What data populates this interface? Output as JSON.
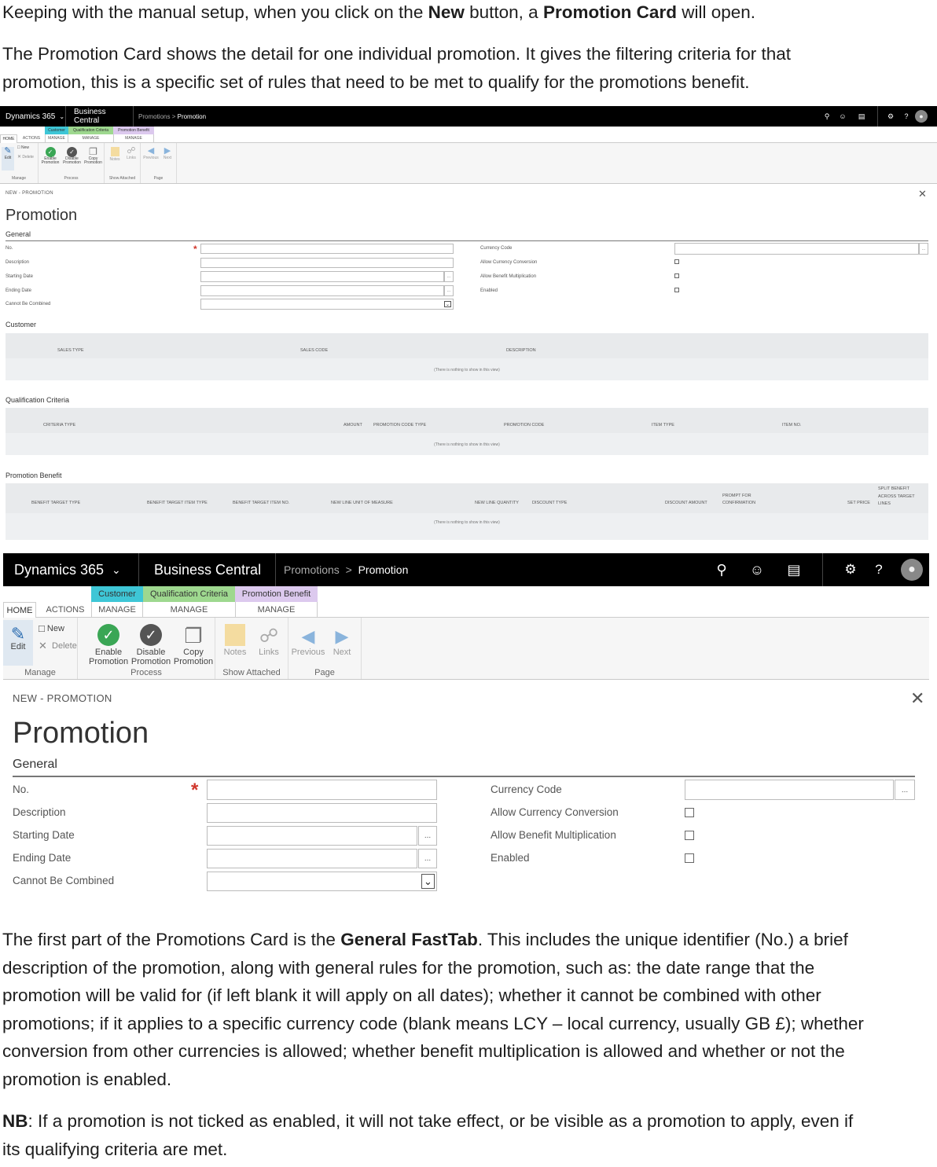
{
  "intro": {
    "p1": {
      "t1": "Keeping with the manual setup, when you click on the ",
      "b1": "New",
      "t2": " button, a ",
      "b2": "Promotion Card",
      "t3": " will open."
    },
    "p2_line1": "The Promotion Card shows the detail for one individual promotion. It gives the filtering criteria for that",
    "p2_line2": "promotion, this is a specific set of rules that need to be met to qualify for the promotions benefit."
  },
  "app": {
    "product": "Dynamics 365",
    "app_name": "Business Central",
    "breadcrumb_parent": "Promotions",
    "breadcrumb_sep": ">",
    "breadcrumb_current": "Promotion",
    "icons": [
      "search-icon",
      "smiley-icon",
      "chat-icon",
      "gear-icon",
      "help-icon",
      "avatar-icon"
    ],
    "help_glyph": "?"
  },
  "ribbon": {
    "contexts": {
      "customer": "Customer",
      "qualification": "Qualification Criteria",
      "benefit": "Promotion Benefit"
    },
    "tabs": {
      "home": "HOME",
      "actions": "ACTIONS",
      "manage1": "MANAGE",
      "manage2": "MANAGE",
      "manage3": "MANAGE"
    },
    "buttons": {
      "edit": "Edit",
      "new": "New",
      "delete": "Delete",
      "enable_1": "Enable",
      "enable_2": "Promotion",
      "disable_1": "Disable",
      "disable_2": "Promotion",
      "copy_1": "Copy",
      "copy_2": "Promotion",
      "notes": "Notes",
      "links": "Links",
      "previous": "Previous",
      "next": "Next"
    },
    "groups": {
      "manage": "Manage",
      "process": "Process",
      "show_attached": "Show Attached",
      "page": "Page"
    }
  },
  "card": {
    "caption": "NEW - PROMOTION",
    "caption_small": "NEW - PROMOTION",
    "title": "Promotion",
    "general": "General",
    "fields_left": {
      "no": "No.",
      "description": "Description",
      "starting_date": "Starting Date",
      "ending_date": "Ending Date",
      "cannot_combine": "Cannot Be Combined"
    },
    "fields_right": {
      "currency_code": "Currency Code",
      "allow_conversion": "Allow Currency Conversion",
      "allow_multiplication": "Allow Benefit Multiplication",
      "enabled": "Enabled"
    },
    "lookup": "...",
    "required": "*",
    "checkboxes": {
      "allow_conversion": false,
      "allow_multiplication": false,
      "enabled": false
    }
  },
  "subpages": {
    "customer": {
      "title": "Customer",
      "cols": [
        "SALES TYPE",
        "SALES CODE",
        "DESCRIPTION"
      ],
      "empty": "(There is nothing to show in this view)"
    },
    "qualification": {
      "title": "Qualification Criteria",
      "cols": [
        "CRITERIA TYPE",
        "AMOUNT",
        "PROMOTION CODE TYPE",
        "PROMOTION CODE",
        "ITEM TYPE",
        "ITEM NO."
      ],
      "empty": "(There is nothing to show in this view)"
    },
    "benefit": {
      "title": "Promotion Benefit",
      "cols": [
        "BENEFIT TARGET TYPE",
        "BENEFIT TARGET ITEM TYPE",
        "BENEFIT TARGET ITEM NO.",
        "NEW LINE UNIT OF MEASURE",
        "NEW LINE QUANTITY",
        "DISCOUNT TYPE",
        "DISCOUNT AMOUNT",
        "PROMPT FOR CONFIRMATION",
        "SET PRICE",
        "SPLIT BENEFIT ACROSS TARGET LINES"
      ],
      "empty": "(There is nothing to show in this view)"
    }
  },
  "outro": {
    "p3": {
      "t1": "The first part of the Promotions Card is the ",
      "b1": "General FastTab",
      "t2": ". This includes the unique identifier (No.) a brief",
      "l2": "description of the promotion, along with general rules for the promotion, such as: the date range that the",
      "l3": "promotion will be valid for (if left blank it will apply on all dates); whether it cannot be combined with other",
      "l4": "promotions; if it applies to a specific currency code (blank means LCY – local currency, usually GB £); whether",
      "l5": "conversion from other currencies is allowed; whether benefit multiplication is allowed and whether or not the",
      "l6": "promotion is enabled."
    },
    "p4": {
      "b1": "NB",
      "t1": ": If a promotion is not ticked as enabled, it will not take effect, or be visible as a promotion to apply, even if",
      "l2": "its qualifying criteria are met."
    }
  },
  "colors": {
    "topbar": "#000000",
    "ctx_customer": "#3ec6d6",
    "ctx_qualification": "#9ed88f",
    "ctx_benefit": "#dcc9ee",
    "required": "#d0362b",
    "enable_icon": "#3aa655",
    "nav_arrow": "#8ab4dc"
  }
}
